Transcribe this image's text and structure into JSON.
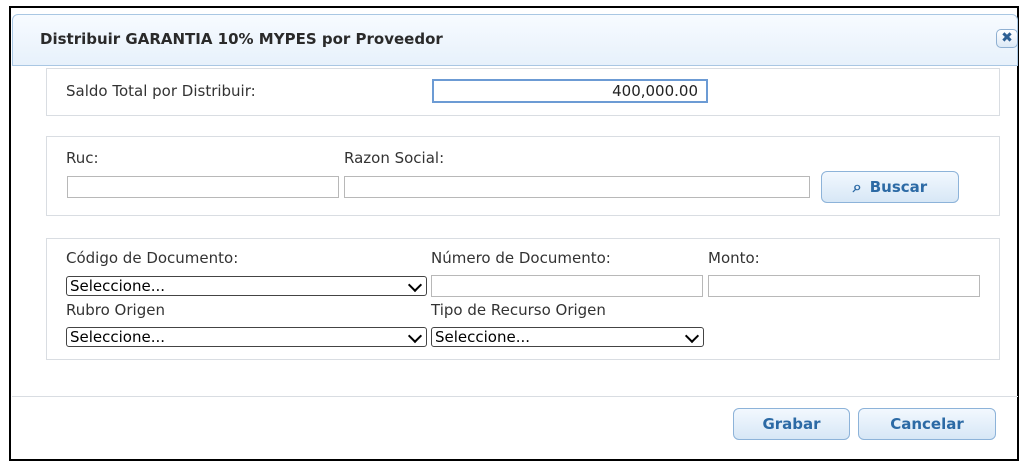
{
  "dialog": {
    "title": "Distribuir GARANTIA 10% MYPES por Proveedor",
    "close_icon": "✖"
  },
  "saldo": {
    "label": "Saldo Total por Distribuir:",
    "value": "400,000.00"
  },
  "search": {
    "ruc_label": "Ruc:",
    "ruc_value": "",
    "razon_label": "Razon Social:",
    "razon_value": "",
    "buscar_label": "Buscar",
    "buscar_icon": "⌕"
  },
  "documento": {
    "codigo_label": "Código de Documento:",
    "codigo_selected": "Seleccione...",
    "numero_label": "Número de Documento:",
    "numero_value": "",
    "monto_label": "Monto:",
    "monto_value": "",
    "rubro_label": "Rubro Origen",
    "rubro_selected": "Seleccione...",
    "tipo_label": "Tipo de Recurso Origen",
    "tipo_selected": "Seleccione..."
  },
  "footer": {
    "grabar_label": "Grabar",
    "cancelar_label": "Cancelar"
  }
}
